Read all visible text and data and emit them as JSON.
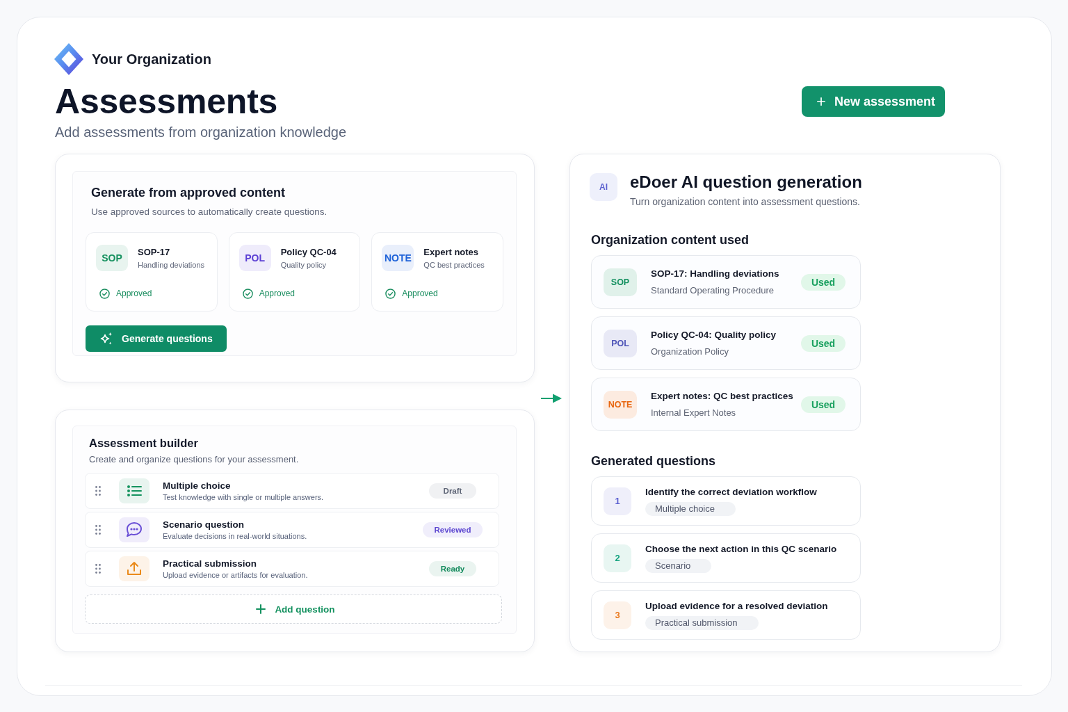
{
  "header": {
    "organization": "Your Organization",
    "title": "Assessments",
    "subtitle": "Add assessments from organization knowledge"
  },
  "new_button": {
    "label": "New assessment"
  },
  "generate_panel": {
    "title": "Generate from approved content",
    "subtitle": "Use approved sources to automatically create questions.",
    "sources": [
      {
        "badge": "SOP",
        "color": "#16915f",
        "title": "SOP-17",
        "subtitle": "Handling deviations",
        "status": "Approved"
      },
      {
        "badge": "POL",
        "color": "#5b3fd4",
        "title": "Policy QC-04",
        "subtitle": "Quality policy",
        "status": "Approved"
      },
      {
        "badge": "NOTE",
        "color": "#1e62d8",
        "title": "Expert notes",
        "subtitle": "QC best practices",
        "status": "Approved"
      }
    ],
    "button": {
      "label": "Generate questions"
    }
  },
  "builder": {
    "title": "Assessment builder",
    "subtitle": "Create and organize questions for your assessment.",
    "items": [
      {
        "kind": "choice",
        "color": "#15935f",
        "title": "Multiple choice",
        "description": "Test knowledge with single or multiple answers.",
        "status": {
          "label": "Draft",
          "color": "#5d6475"
        }
      },
      {
        "kind": "scenario",
        "color": "#6a4fd6",
        "title": "Scenario question",
        "description": "Evaluate decisions in real-world situations.",
        "status": {
          "label": "Reviewed",
          "color": "#5b45d0"
        }
      },
      {
        "kind": "submission",
        "color": "#ea8a1a",
        "title": "Practical submission",
        "description": "Upload evidence or artifacts for evaluation.",
        "status": {
          "label": "Ready",
          "color": "#138a5c"
        }
      }
    ],
    "add_button": {
      "label": "Add question"
    }
  },
  "ai_panel": {
    "badge": "AI",
    "title": "eDoer AI question generation",
    "subtitle": "Turn organization content into assessment questions.",
    "content_heading": "Organization content used",
    "content": [
      {
        "badge": "SOP",
        "color": "#14905f",
        "title": "SOP-17: Handling deviations",
        "subtitle": "Standard Operating Procedure",
        "status": "Used"
      },
      {
        "badge": "POL",
        "color": "#4f55b8",
        "title": "Policy QC-04: Quality policy",
        "subtitle": "Organization Policy",
        "status": "Used"
      },
      {
        "badge": "NOTE",
        "color": "#e8650e",
        "title": "Expert notes: QC best practices",
        "subtitle": "Internal Expert Notes",
        "status": "Used"
      }
    ],
    "questions_heading": "Generated questions",
    "questions": [
      {
        "number": "1",
        "color": "#5a5fd0",
        "text": "Identify the correct deviation workflow",
        "type": "Multiple choice"
      },
      {
        "number": "2",
        "color": "#14a37f",
        "text": "Choose the next action in this QC scenario",
        "type": "Scenario"
      },
      {
        "number": "3",
        "color": "#ea7a1e",
        "text": "Upload evidence for a resolved deviation",
        "type": "Practical submission"
      }
    ]
  }
}
